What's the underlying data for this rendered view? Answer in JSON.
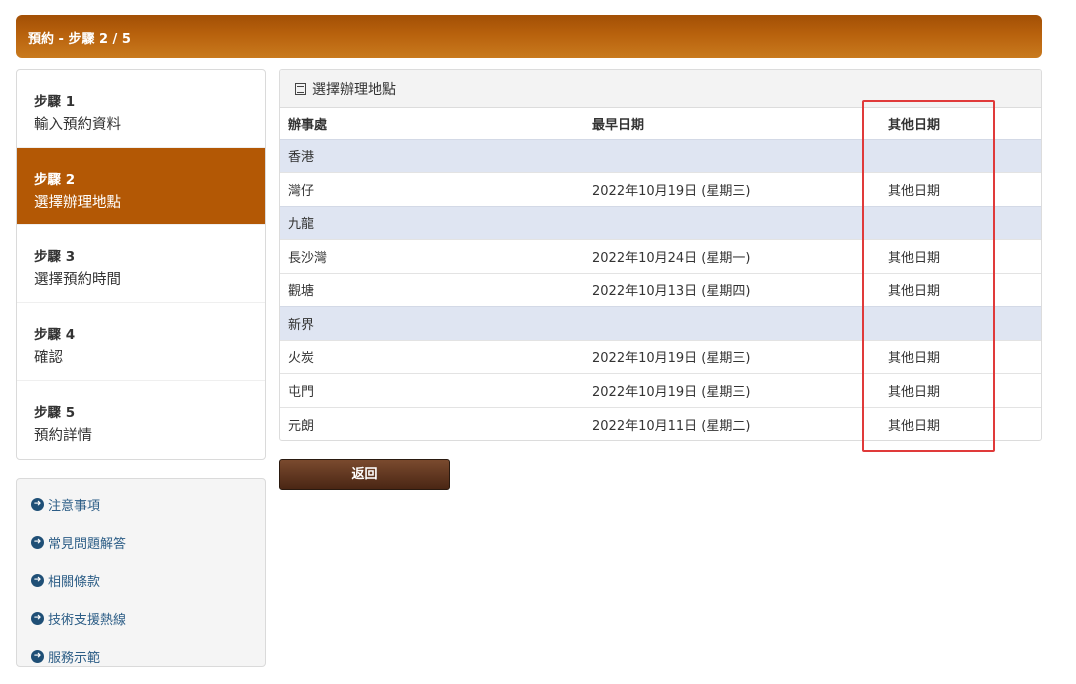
{
  "header": {
    "title": "預約 - 步驟 2 / 5"
  },
  "steps": [
    {
      "number": "步驟 1",
      "label": "輸入預約資料"
    },
    {
      "number": "步驟 2",
      "label": "選擇辦理地點"
    },
    {
      "number": "步驟 3",
      "label": "選擇預約時間"
    },
    {
      "number": "步驟 4",
      "label": "確認"
    },
    {
      "number": "步驟 5",
      "label": "預約詳情"
    }
  ],
  "links": [
    "注意事項",
    "常見問題解答",
    "相關條款",
    "技術支援熱線",
    "服務示範"
  ],
  "panel": {
    "title": "選擇辦理地點",
    "columns": [
      "辦事處",
      "最早日期",
      "其他日期"
    ],
    "other_dates_label": "其他日期",
    "regions": [
      {
        "name": "香港",
        "offices": [
          {
            "name": "灣仔",
            "date": "2022年10月19日 (星期三)"
          }
        ]
      },
      {
        "name": "九龍",
        "offices": [
          {
            "name": "長沙灣",
            "date": "2022年10月24日 (星期一)"
          },
          {
            "name": "觀塘",
            "date": "2022年10月13日 (星期四)"
          }
        ]
      },
      {
        "name": "新界",
        "offices": [
          {
            "name": "火炭",
            "date": "2022年10月19日 (星期三)"
          },
          {
            "name": "屯門",
            "date": "2022年10月19日 (星期三)"
          },
          {
            "name": "元朗",
            "date": "2022年10月11日 (星期二)"
          }
        ]
      }
    ]
  },
  "back_button": "返回",
  "colors": {
    "accent": "#b35805",
    "highlight": "#e03a3a",
    "region_row": "#dfe5f2"
  }
}
